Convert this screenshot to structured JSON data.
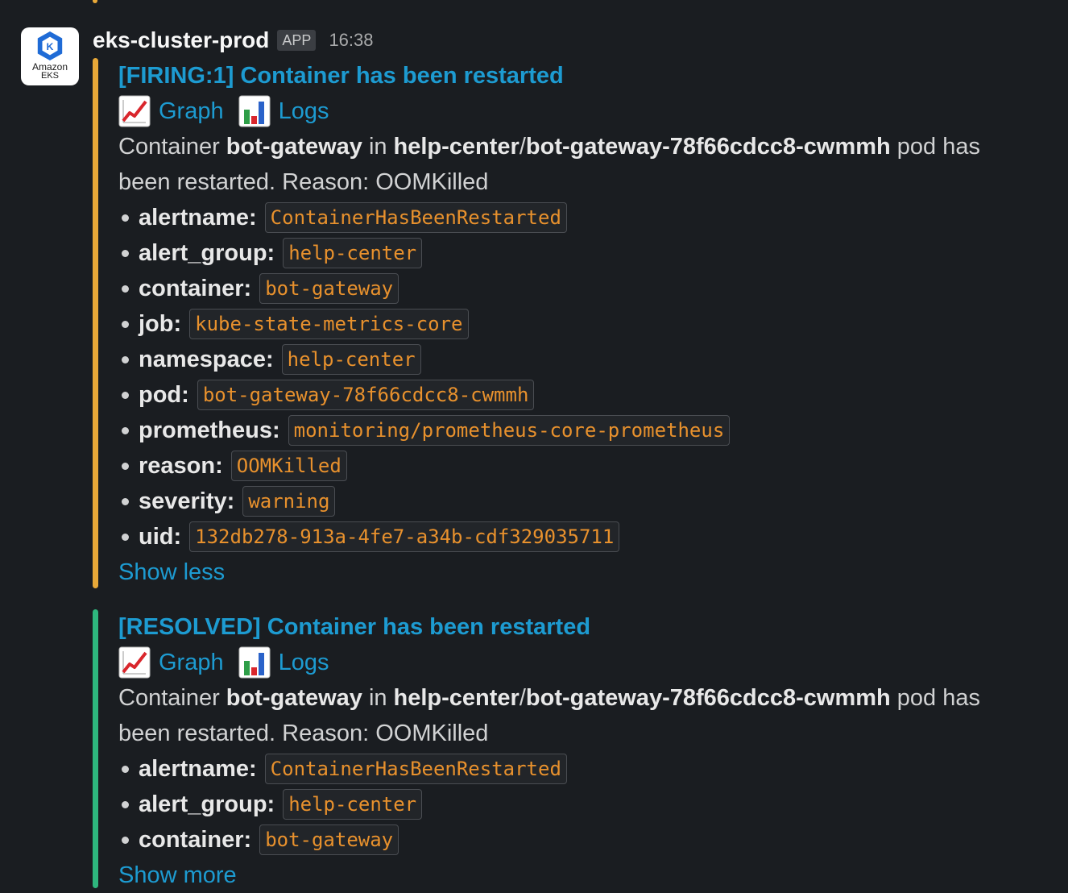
{
  "sender": {
    "name": "eks-cluster-prod",
    "badge": "APP",
    "time": "16:38"
  },
  "avatar": {
    "line1": "Amazon",
    "line2": "EKS",
    "letter": "K"
  },
  "colors": {
    "firing": "#e8a838",
    "resolved": "#2eb67d",
    "link": "#1d9bd1",
    "code": "#e8912d"
  },
  "alerts": [
    {
      "title": "[FIRING:1] Container has been restarted",
      "graph_label": "Graph",
      "logs_label": "Logs",
      "desc": {
        "p1": "Container ",
        "container": "bot-gateway",
        "p2": " in ",
        "namespace": "help-center",
        "sep": "/",
        "pod": "bot-gateway-78f66cdcc8-cwmmh",
        "p3": " pod has",
        "line2": "been restarted. Reason: OOMKilled"
      },
      "labels": [
        {
          "key": "alertname:",
          "value": "ContainerHasBeenRestarted"
        },
        {
          "key": "alert_group:",
          "value": "help-center"
        },
        {
          "key": "container:",
          "value": "bot-gateway"
        },
        {
          "key": "job:",
          "value": "kube-state-metrics-core"
        },
        {
          "key": "namespace:",
          "value": "help-center"
        },
        {
          "key": "pod:",
          "value": "bot-gateway-78f66cdcc8-cwmmh"
        },
        {
          "key": "prometheus:",
          "value": "monitoring/prometheus-core-prometheus"
        },
        {
          "key": "reason:",
          "value": "OOMKilled"
        },
        {
          "key": "severity:",
          "value": "warning"
        },
        {
          "key": "uid:",
          "value": "132db278-913a-4fe7-a34b-cdf329035711"
        }
      ],
      "toggle": "Show less"
    },
    {
      "title": "[RESOLVED] Container has been restarted",
      "graph_label": "Graph",
      "logs_label": "Logs",
      "desc": {
        "p1": "Container ",
        "container": "bot-gateway",
        "p2": " in ",
        "namespace": "help-center",
        "sep": "/",
        "pod": "bot-gateway-78f66cdcc8-cwmmh",
        "p3": " pod has",
        "line2": "been restarted. Reason: OOMKilled"
      },
      "labels": [
        {
          "key": "alertname:",
          "value": "ContainerHasBeenRestarted"
        },
        {
          "key": "alert_group:",
          "value": "help-center"
        },
        {
          "key": "container:",
          "value": "bot-gateway"
        }
      ],
      "toggle": "Show more"
    }
  ],
  "icons": {
    "graph": "chart-increasing-icon",
    "logs": "bar-chart-icon"
  }
}
